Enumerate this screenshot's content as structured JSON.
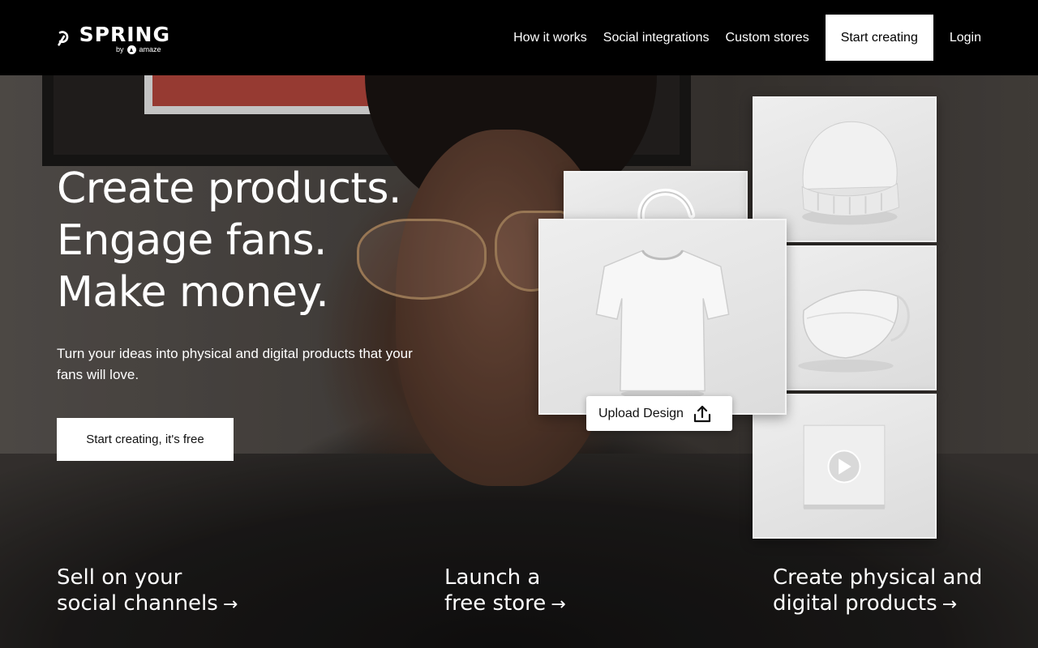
{
  "brand": {
    "name": "SPRING",
    "byline": "by",
    "partner": "amaze"
  },
  "nav": {
    "items": [
      "How it works",
      "Social integrations",
      "Custom stores"
    ],
    "cta": "Start creating",
    "login": "Login"
  },
  "hero": {
    "headline": [
      "Create products.",
      "Engage fans.",
      "Make money."
    ],
    "subtext": "Turn your ideas into physical and digital products that your fans will love.",
    "cta": "Start creating, it's free"
  },
  "products": {
    "upload_label": "Upload Design",
    "items": [
      "tote-bag",
      "t-shirt",
      "beanie",
      "face-mask",
      "video"
    ]
  },
  "features": [
    {
      "line1": "Sell on your",
      "line2": "social channels",
      "arrow": "→"
    },
    {
      "line1": "Launch a",
      "line2": "free store",
      "arrow": "→"
    },
    {
      "line1": "Create physical and",
      "line2": "digital products",
      "arrow": "→"
    }
  ]
}
